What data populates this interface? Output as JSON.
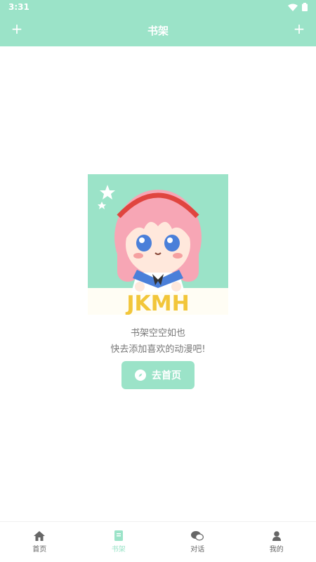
{
  "status_bar": {
    "time": "3:31",
    "wifi_icon": "wifi-icon",
    "battery_icon": "battery-icon"
  },
  "header": {
    "title": "书架",
    "left_action": "+",
    "right_action": "+"
  },
  "empty_state": {
    "image_text": "JKMH",
    "line1": "书架空空如也",
    "line2": "快去添加喜欢的动漫吧!",
    "button_label": "去首页",
    "button_icon": "compass-icon"
  },
  "tabbar": {
    "items": [
      {
        "label": "首页",
        "icon": "home-icon",
        "active": false
      },
      {
        "label": "书架",
        "icon": "book-icon",
        "active": true
      },
      {
        "label": "对话",
        "icon": "chat-icon",
        "active": false
      },
      {
        "label": "我的",
        "icon": "person-icon",
        "active": false
      }
    ]
  },
  "colors": {
    "accent": "#9be3c8",
    "text_muted": "#777777",
    "tab_inactive": "#666666"
  }
}
